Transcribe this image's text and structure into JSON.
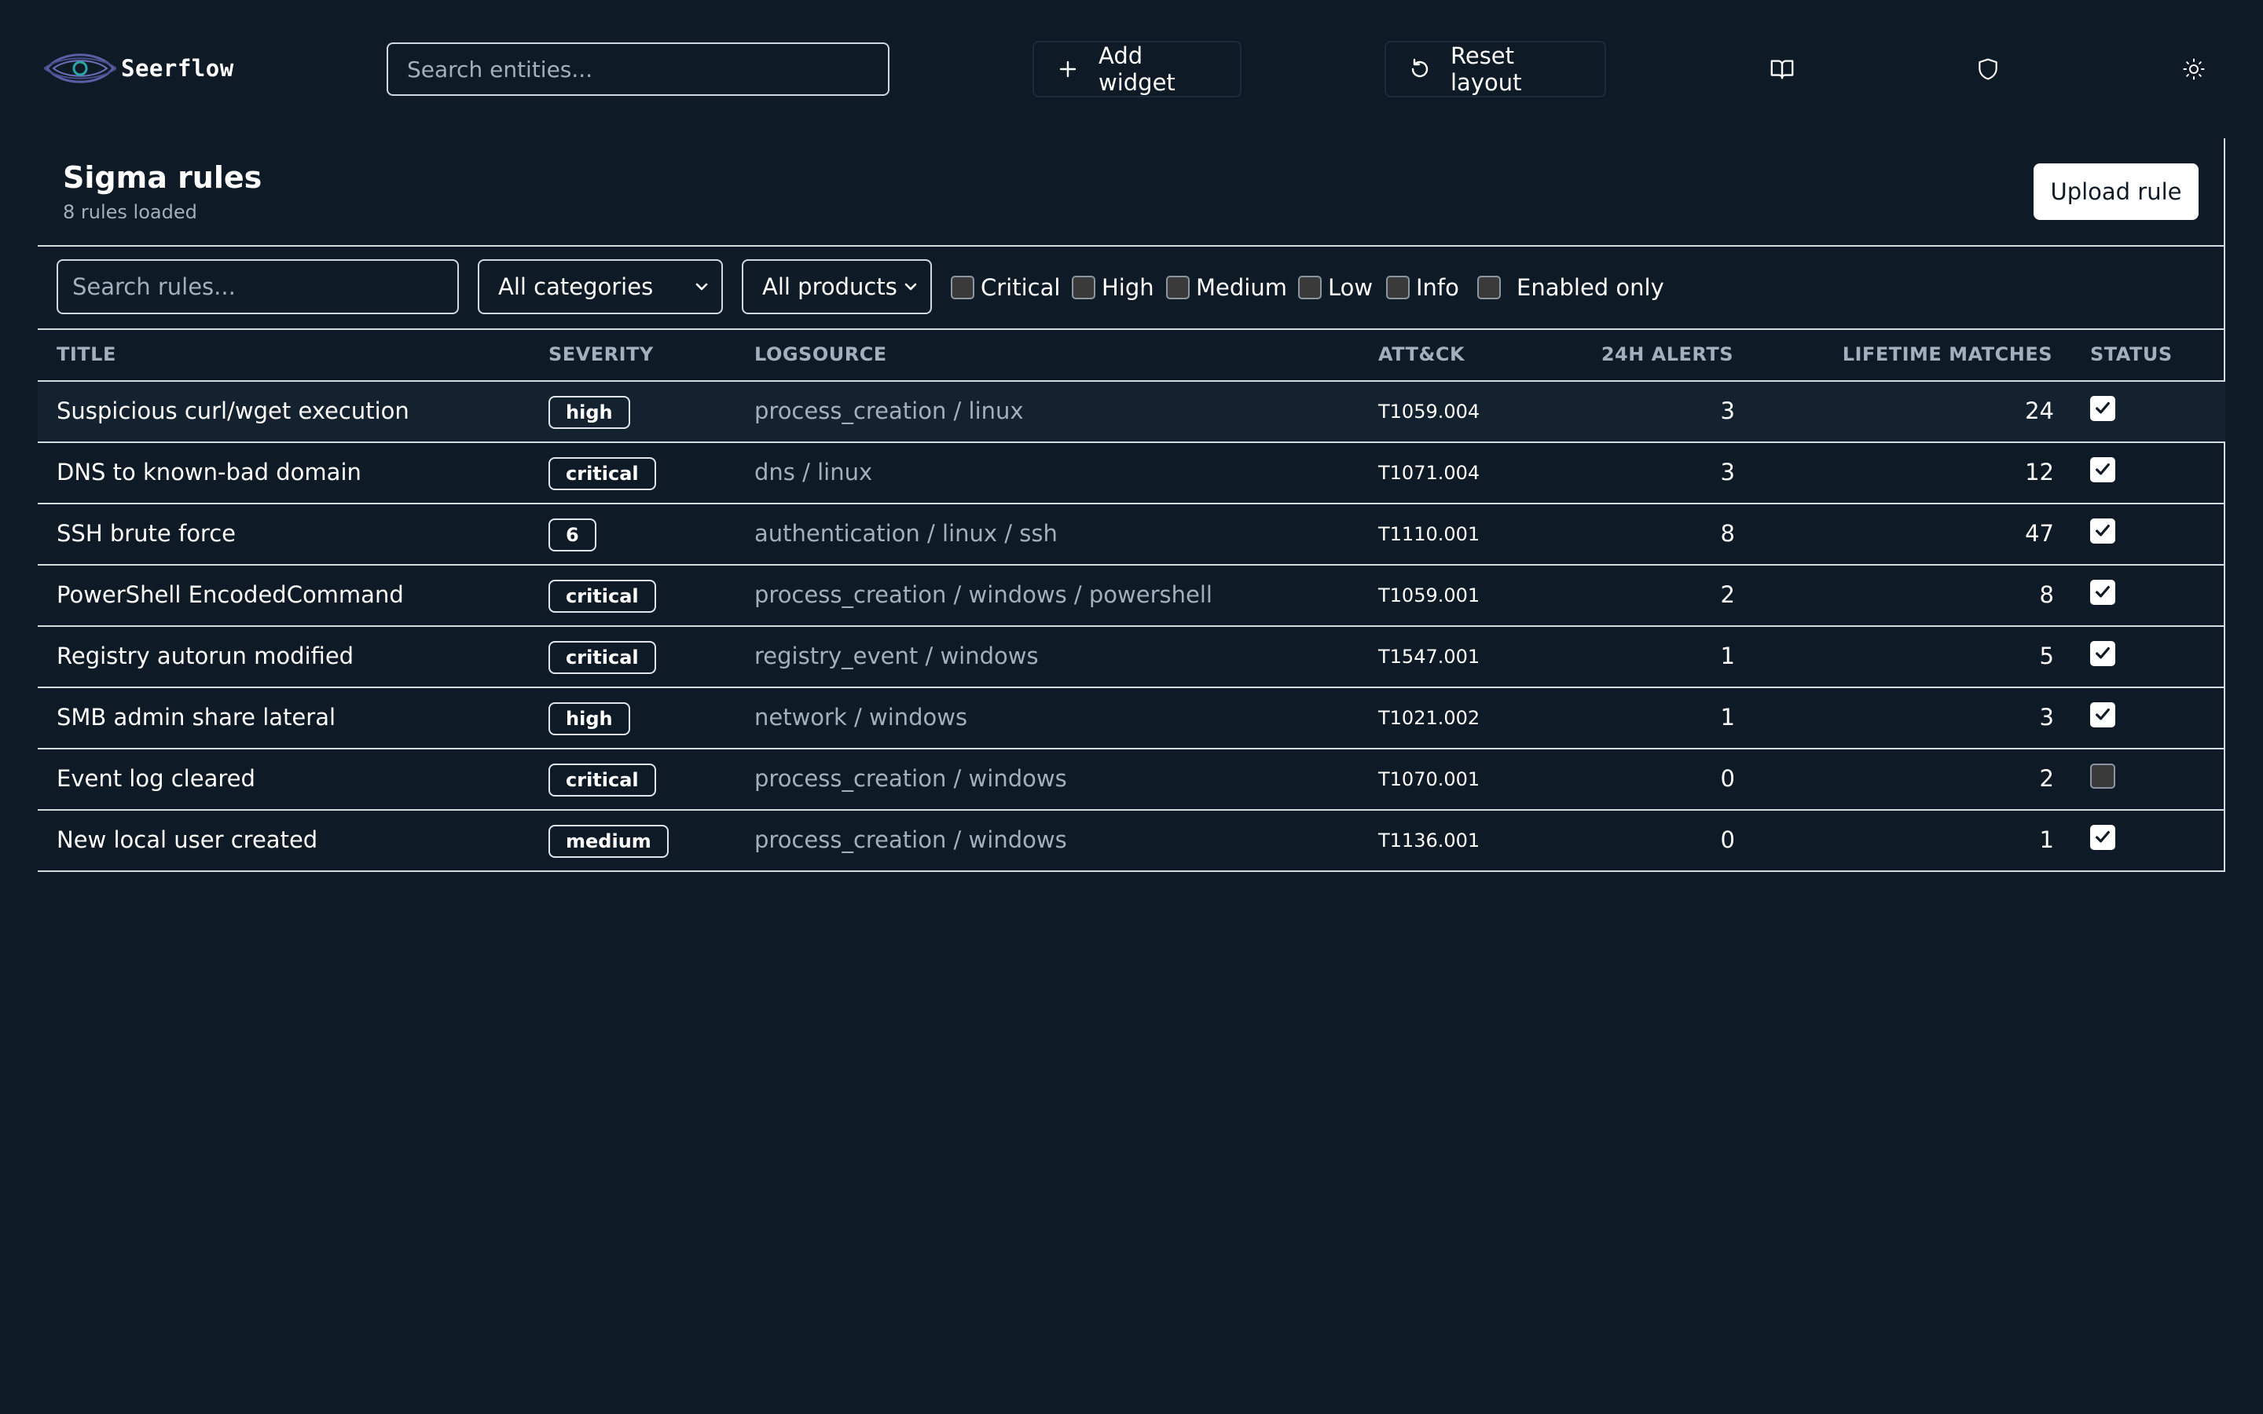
{
  "app": {
    "name": "Seerflow"
  },
  "topbar": {
    "search_placeholder": "Search entities...",
    "add_widget_label": "Add widget",
    "reset_layout_label": "Reset layout"
  },
  "panel": {
    "title": "Sigma rules",
    "subtitle": "8 rules loaded",
    "upload_label": "Upload rule"
  },
  "filters": {
    "search_placeholder": "Search rules...",
    "category_value": "All categories",
    "product_value": "All products",
    "severity_checks": [
      {
        "label": "Critical",
        "checked": false
      },
      {
        "label": "High",
        "checked": false
      },
      {
        "label": "Medium",
        "checked": false
      },
      {
        "label": "Low",
        "checked": false
      },
      {
        "label": "Info",
        "checked": false
      }
    ],
    "enabled_only": {
      "label": "Enabled only",
      "checked": false
    }
  },
  "table": {
    "headers": [
      "TITLE",
      "SEVERITY",
      "LOGSOURCE",
      "ATT&CK",
      "24H ALERTS",
      "LIFETIME MATCHES",
      "STATUS"
    ],
    "rows": [
      {
        "title": "Suspicious curl/wget execution",
        "severity": "high",
        "logsource": "process_creation / linux",
        "attck": "T1059.004",
        "alerts_24h": "3",
        "lifetime": "24",
        "enabled": true
      },
      {
        "title": "DNS to known-bad domain",
        "severity": "critical",
        "logsource": "dns / linux",
        "attck": "T1071.004",
        "alerts_24h": "3",
        "lifetime": "12",
        "enabled": true
      },
      {
        "title": "SSH brute force",
        "severity": "6",
        "logsource": "authentication / linux / ssh",
        "attck": "T1110.001",
        "alerts_24h": "8",
        "lifetime": "47",
        "enabled": true
      },
      {
        "title": "PowerShell EncodedCommand",
        "severity": "critical",
        "logsource": "process_creation / windows / powershell",
        "attck": "T1059.001",
        "alerts_24h": "2",
        "lifetime": "8",
        "enabled": true
      },
      {
        "title": "Registry autorun modified",
        "severity": "critical",
        "logsource": "registry_event / windows",
        "attck": "T1547.001",
        "alerts_24h": "1",
        "lifetime": "5",
        "enabled": true
      },
      {
        "title": "SMB admin share lateral",
        "severity": "high",
        "logsource": "network / windows",
        "attck": "T1021.002",
        "alerts_24h": "1",
        "lifetime": "3",
        "enabled": true
      },
      {
        "title": "Event log cleared",
        "severity": "critical",
        "logsource": "process_creation / windows",
        "attck": "T1070.001",
        "alerts_24h": "0",
        "lifetime": "2",
        "enabled": false
      },
      {
        "title": "New local user created",
        "severity": "medium",
        "logsource": "process_creation / windows",
        "attck": "T1136.001",
        "alerts_24h": "0",
        "lifetime": "1",
        "enabled": true
      }
    ]
  },
  "icons": {
    "logo": "eye-logo-icon",
    "add": "plus-icon",
    "reset": "rotate-ccw-icon",
    "docs": "book-open-icon",
    "security": "shield-icon",
    "theme": "sun-icon",
    "select": "chevron-down-icon",
    "check": "checkmark-icon"
  },
  "colors": {
    "background": "#0e1a25",
    "border": "#d3dbe3",
    "muted_text": "#a3afbc",
    "highlight_row": "#142230",
    "logo_accent": "#5b5ea6",
    "logo_pupil": "#2aa8a8"
  }
}
